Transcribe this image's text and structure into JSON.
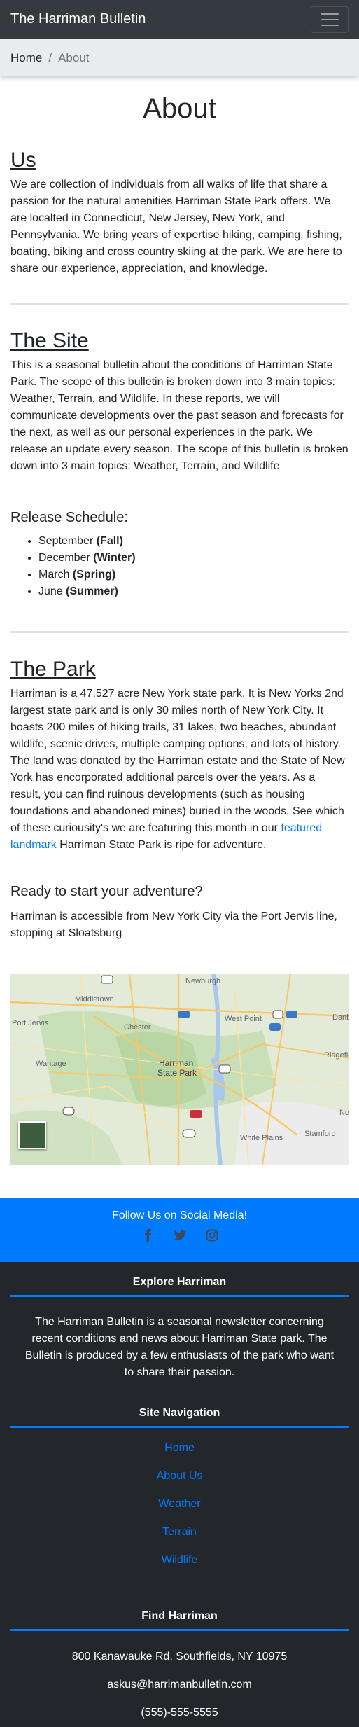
{
  "navbar": {
    "brand": "The Harriman Bulletin"
  },
  "breadcrumb": {
    "home": "Home",
    "separator": "/",
    "current": "About"
  },
  "page": {
    "title": "About"
  },
  "sections": {
    "us": {
      "heading": "Us",
      "text": "We are collection of individuals from all walks of life that share a passion for the natural amenities Harriman State Park offers. We are localted in Connecticut, New Jersey, New York, and Pennsylvania. We bring years of expertise hiking, camping, fishing, boating, biking and cross country skiing at the park. We are here to share our experience, appreciation, and knowledge."
    },
    "site": {
      "heading": "The Site",
      "text": "This is a seasonal bulletin about the conditions of Harriman State Park. The scope of this bulletin is broken down into 3 main topics: Weather, Terrain, and Wildlife. In these reports, we will communicate developments over the past season and forecasts for the next, as well as our personal experiences in the park. We release an update every season. The scope of this bulletin is broken down into 3 main topics: Weather, Terrain, and Wildlife",
      "schedule_heading": "Release Schedule:",
      "schedule": [
        {
          "month": "September",
          "season": "(Fall)"
        },
        {
          "month": "December",
          "season": "(Winter)"
        },
        {
          "month": "March",
          "season": "(Spring)"
        },
        {
          "month": "June",
          "season": "(Summer)"
        }
      ]
    },
    "park": {
      "heading": "The Park",
      "text_before_link": "Harriman is a 47,527 acre New York state park. It is New Yorks 2nd largest state park and is only 30 miles north of New York City. It boasts 200 miles of hiking trails, 31 lakes, two beaches, abundant wildlife, scenic drives, multiple camping options, and lots of history. The land was donated by the Harriman estate and the State of New York has encorporated additional parcels over the years. As a result, you can find ruinous developments (such as housing foundations and abandoned mines) buried in the woods. See which of these curiousity's we are featuring this month in our",
      "link_text": "featured landmark",
      "text_after_link": "Harriman State Park is ripe for adventure.",
      "adventure_heading": "Ready to start your adventure?",
      "adventure_text": "Harriman is accessible from New York City via the Port Jervis line, stopping at Sloatsburg"
    }
  },
  "map": {
    "labels": {
      "newburgh": "Newburgh",
      "middletown": "Middletown",
      "port_jervis": "Port Jervis",
      "chester": "Chester",
      "west_point": "West Point",
      "danbury": "Danbu",
      "ridgefield": "Ridgefiel",
      "wantage": "Wantage",
      "harriman": "Harriman",
      "state_park": "State Park",
      "white_plains": "White Plains",
      "stamford": "Stamford",
      "no": "No"
    },
    "shields": [
      "87",
      "9",
      "84",
      "684",
      "9",
      "287",
      "444",
      "23",
      "6"
    ]
  },
  "social": {
    "title": "Follow Us on Social Media!",
    "icons": [
      "facebook-icon",
      "twitter-icon",
      "instagram-icon"
    ],
    "accent": "#007bff"
  },
  "footer": {
    "explore_heading": "Explore Harriman",
    "explore_text": "The Harriman Bulletin is a seasonal newsletter concerning recent conditions and news about Harriman State park. The Bulletin is produced by a few enthusiasts of the park who want to share their passion.",
    "nav_heading": "Site Navigation",
    "nav_links": [
      "Home",
      "About Us",
      "Weather",
      "Terrain",
      "Wildlife"
    ],
    "find_heading": "Find Harriman",
    "address": "800 Kanawauke Rd, Southfields, NY 10975",
    "email": "askus@harrimanbulletin.com",
    "phone": "(555)-555-5555",
    "background": "#23272b"
  }
}
